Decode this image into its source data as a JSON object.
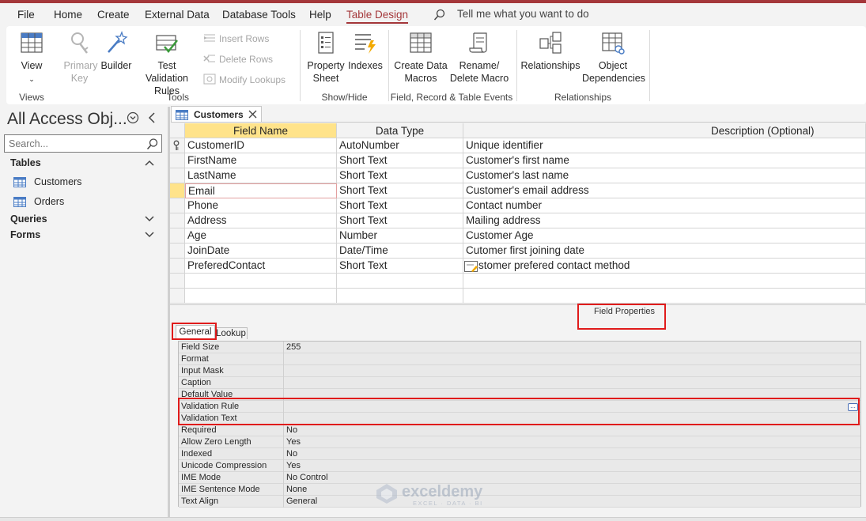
{
  "menu": {
    "tabs": [
      "File",
      "Home",
      "Create",
      "External Data",
      "Database Tools",
      "Help",
      "Table Design"
    ],
    "active_tab": "Table Design",
    "tell_me": "Tell me what you want to do"
  },
  "ribbon": {
    "view": {
      "label": "View"
    },
    "primary_key": {
      "label": "Primary Key"
    },
    "builder": {
      "label": "Builder"
    },
    "test_validation": {
      "label": "Test Validation Rules"
    },
    "insert_rows": "Insert Rows",
    "delete_rows": "Delete Rows",
    "modify_lookups": "Modify Lookups",
    "property_sheet": {
      "label": "Property Sheet"
    },
    "indexes": {
      "label": "Indexes"
    },
    "create_data_macros": {
      "label": "Create Data Macros"
    },
    "rename_delete_macro": {
      "label": "Rename/ Delete Macro"
    },
    "relationships": {
      "label": "Relationships"
    },
    "object_dependencies": {
      "label": "Object Dependencies"
    },
    "groups": {
      "views": "Views",
      "tools": "Tools",
      "show_hide": "Show/Hide",
      "events": "Field, Record & Table Events",
      "relationships": "Relationships"
    }
  },
  "nav": {
    "title": "All Access Obj...",
    "search_placeholder": "Search...",
    "sections": {
      "tables": "Tables",
      "queries": "Queries",
      "forms": "Forms"
    },
    "tables": [
      "Customers",
      "Orders"
    ]
  },
  "doc_tab": {
    "label": "Customers"
  },
  "design_grid": {
    "headers": {
      "field_name": "Field Name",
      "data_type": "Data Type",
      "description": "Description (Optional)"
    },
    "rows": [
      {
        "field": "CustomerID",
        "type": "AutoNumber",
        "desc": "Unique identifier"
      },
      {
        "field": "FirstName",
        "type": "Short Text",
        "desc": "Customer's first name"
      },
      {
        "field": "LastName",
        "type": "Short Text",
        "desc": "Customer's last name"
      },
      {
        "field": "Email",
        "type": "Short Text",
        "desc": "Customer's email address"
      },
      {
        "field": "Phone",
        "type": "Short Text",
        "desc": "Contact number"
      },
      {
        "field": "Address",
        "type": "Short Text",
        "desc": "Mailing address"
      },
      {
        "field": "Age",
        "type": "Number",
        "desc": "Customer Age"
      },
      {
        "field": "JoinDate",
        "type": "Date/Time",
        "desc": "Cutomer first joining  date"
      },
      {
        "field": "PreferedContact",
        "type": "Short Text",
        "desc": "stomer prefered contact method"
      },
      {
        "field": "",
        "type": "",
        "desc": ""
      },
      {
        "field": "",
        "type": "",
        "desc": ""
      }
    ]
  },
  "field_properties": {
    "title": "Field Properties",
    "tabs": {
      "general": "General",
      "lookup": "Lookup"
    },
    "rows": [
      {
        "name": "Field Size",
        "value": "255"
      },
      {
        "name": "Format",
        "value": ""
      },
      {
        "name": "Input Mask",
        "value": ""
      },
      {
        "name": "Caption",
        "value": ""
      },
      {
        "name": "Default Value",
        "value": ""
      },
      {
        "name": "Validation Rule",
        "value": ""
      },
      {
        "name": "Validation Text",
        "value": ""
      },
      {
        "name": "Required",
        "value": "No"
      },
      {
        "name": "Allow Zero Length",
        "value": "Yes"
      },
      {
        "name": "Indexed",
        "value": "No"
      },
      {
        "name": "Unicode Compression",
        "value": "Yes"
      },
      {
        "name": "IME Mode",
        "value": "No Control"
      },
      {
        "name": "IME Sentence Mode",
        "value": "None"
      },
      {
        "name": "Text Align",
        "value": "General"
      }
    ],
    "builder_button": "..."
  },
  "watermark": {
    "name": "exceldemy",
    "sub": "EXCEL · DATA · BI"
  },
  "colors": {
    "accent": "#a4373a",
    "selection": "#ffe38a",
    "highlight_box": "#e01b1b"
  }
}
